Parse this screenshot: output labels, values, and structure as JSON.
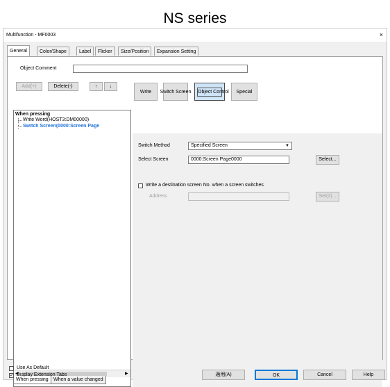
{
  "heading": "NS series",
  "window": {
    "title": "Multifunction - MF0003",
    "close": "×"
  },
  "tabs": [
    "General",
    "Color/Shape",
    "Label",
    "Flicker",
    "Size/Position",
    "Expansion Setting"
  ],
  "object_comment": {
    "label": "Object Comment",
    "value": ""
  },
  "list_toolbar": {
    "add": "Add(+)",
    "delete": "Delete(-)",
    "up": "↑",
    "down": "↓"
  },
  "func_buttons": {
    "write": "Write",
    "switch_screen": "Switch Screen",
    "object_control": "Object Control",
    "special": "Special"
  },
  "tree": {
    "root": "When pressing",
    "items": [
      "Write Word(HOST3:DM00000)",
      "Switch Screen(0000:Screen Page"
    ]
  },
  "bottom_tabs": [
    "When pressing",
    "When a value changed"
  ],
  "switch_method": {
    "label": "Switch Method",
    "value": "Specified Screen"
  },
  "select_screen": {
    "label": "Select Screen",
    "value": "0000:Screen Page0000",
    "button": "Select..."
  },
  "write_dest": {
    "label": "Write a destination screen No. when a screen switches",
    "checked": false
  },
  "address": {
    "label": "Address",
    "value": "",
    "button": "Set(2)..."
  },
  "footer": {
    "use_default": {
      "label": "Use As Default",
      "checked": false
    },
    "display_tabs": {
      "label": "Display Extension Tabs",
      "checked": true
    },
    "apply": "適用(A)",
    "ok": "OK",
    "cancel": "Cancel",
    "help": "Help"
  }
}
